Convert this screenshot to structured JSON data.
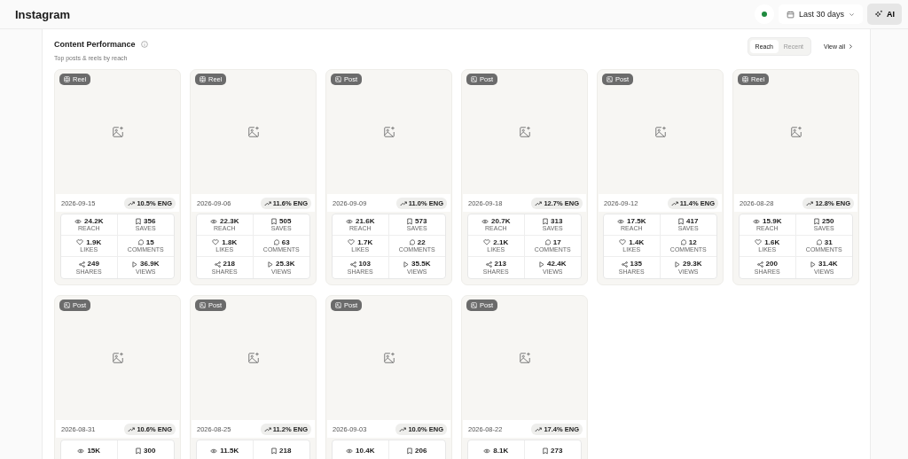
{
  "header": {
    "title": "Instagram",
    "status": {
      "color": "#1e8a3e"
    },
    "date_range": "Last 30 days",
    "ai_button": "AI"
  },
  "section": {
    "title": "Content Performance",
    "subtitle": "Top posts & reels by reach",
    "view_all": "View all",
    "sort_tabs": [
      {
        "label": "Reach",
        "selected": true
      },
      {
        "label": "Recent",
        "selected": false
      }
    ]
  },
  "posts": [
    {
      "kind": "reel",
      "badge": "Reel",
      "date": "2026-09-15",
      "engagement": "10.5% ENG",
      "stats": [
        {
          "kind": "reach",
          "value": "24.2K",
          "label": "REACH"
        },
        {
          "kind": "saves",
          "value": "356",
          "label": "SAVES"
        },
        {
          "kind": "likes",
          "value": "1.9K",
          "label": "LIKES"
        },
        {
          "kind": "comments",
          "value": "15",
          "label": "COMMENTS"
        },
        {
          "kind": "shares",
          "value": "249",
          "label": "SHARES"
        },
        {
          "kind": "views",
          "value": "36.9K",
          "label": "VIEWS"
        }
      ]
    },
    {
      "kind": "reel",
      "badge": "Reel",
      "date": "2026-09-06",
      "engagement": "11.6% ENG",
      "stats": [
        {
          "kind": "reach",
          "value": "22.3K",
          "label": "REACH"
        },
        {
          "kind": "saves",
          "value": "505",
          "label": "SAVES"
        },
        {
          "kind": "likes",
          "value": "1.8K",
          "label": "LIKES"
        },
        {
          "kind": "comments",
          "value": "63",
          "label": "COMMENTS"
        },
        {
          "kind": "shares",
          "value": "218",
          "label": "SHARES"
        },
        {
          "kind": "views",
          "value": "25.3K",
          "label": "VIEWS"
        }
      ]
    },
    {
      "kind": "post",
      "badge": "Post",
      "date": "2026-09-09",
      "engagement": "11.0% ENG",
      "stats": [
        {
          "kind": "reach",
          "value": "21.6K",
          "label": "REACH"
        },
        {
          "kind": "saves",
          "value": "573",
          "label": "SAVES"
        },
        {
          "kind": "likes",
          "value": "1.7K",
          "label": "LIKES"
        },
        {
          "kind": "comments",
          "value": "22",
          "label": "COMMENTS"
        },
        {
          "kind": "shares",
          "value": "103",
          "label": "SHARES"
        },
        {
          "kind": "views",
          "value": "35.5K",
          "label": "VIEWS"
        }
      ]
    },
    {
      "kind": "post",
      "badge": "Post",
      "date": "2026-09-18",
      "engagement": "12.7% ENG",
      "stats": [
        {
          "kind": "reach",
          "value": "20.7K",
          "label": "REACH"
        },
        {
          "kind": "saves",
          "value": "313",
          "label": "SAVES"
        },
        {
          "kind": "likes",
          "value": "2.1K",
          "label": "LIKES"
        },
        {
          "kind": "comments",
          "value": "17",
          "label": "COMMENTS"
        },
        {
          "kind": "shares",
          "value": "213",
          "label": "SHARES"
        },
        {
          "kind": "views",
          "value": "42.4K",
          "label": "VIEWS"
        }
      ]
    },
    {
      "kind": "post",
      "badge": "Post",
      "date": "2026-09-12",
      "engagement": "11.4% ENG",
      "stats": [
        {
          "kind": "reach",
          "value": "17.5K",
          "label": "REACH"
        },
        {
          "kind": "saves",
          "value": "417",
          "label": "SAVES"
        },
        {
          "kind": "likes",
          "value": "1.4K",
          "label": "LIKES"
        },
        {
          "kind": "comments",
          "value": "12",
          "label": "COMMENTS"
        },
        {
          "kind": "shares",
          "value": "135",
          "label": "SHARES"
        },
        {
          "kind": "views",
          "value": "29.3K",
          "label": "VIEWS"
        }
      ]
    },
    {
      "kind": "reel",
      "badge": "Reel",
      "date": "2026-08-28",
      "engagement": "12.8% ENG",
      "stats": [
        {
          "kind": "reach",
          "value": "15.9K",
          "label": "REACH"
        },
        {
          "kind": "saves",
          "value": "250",
          "label": "SAVES"
        },
        {
          "kind": "likes",
          "value": "1.6K",
          "label": "LIKES"
        },
        {
          "kind": "comments",
          "value": "31",
          "label": "COMMENTS"
        },
        {
          "kind": "shares",
          "value": "200",
          "label": "SHARES"
        },
        {
          "kind": "views",
          "value": "31.4K",
          "label": "VIEWS"
        }
      ]
    },
    {
      "kind": "post",
      "badge": "Post",
      "date": "2026-08-31",
      "engagement": "10.6% ENG",
      "stats": [
        {
          "kind": "reach",
          "value": "15K"
        },
        {
          "kind": "saves",
          "value": "300"
        }
      ]
    },
    {
      "kind": "post",
      "badge": "Post",
      "date": "2026-08-25",
      "engagement": "11.2% ENG",
      "stats": [
        {
          "kind": "reach",
          "value": "11.5K"
        },
        {
          "kind": "saves",
          "value": "218"
        }
      ]
    },
    {
      "kind": "post",
      "badge": "Post",
      "date": "2026-09-03",
      "engagement": "10.0% ENG",
      "stats": [
        {
          "kind": "reach",
          "value": "10.4K"
        },
        {
          "kind": "saves",
          "value": "206"
        }
      ]
    },
    {
      "kind": "post",
      "badge": "Post",
      "date": "2026-08-22",
      "engagement": "17.4% ENG",
      "stats": [
        {
          "kind": "reach",
          "value": "8.1K"
        },
        {
          "kind": "saves",
          "value": "273"
        }
      ]
    }
  ]
}
